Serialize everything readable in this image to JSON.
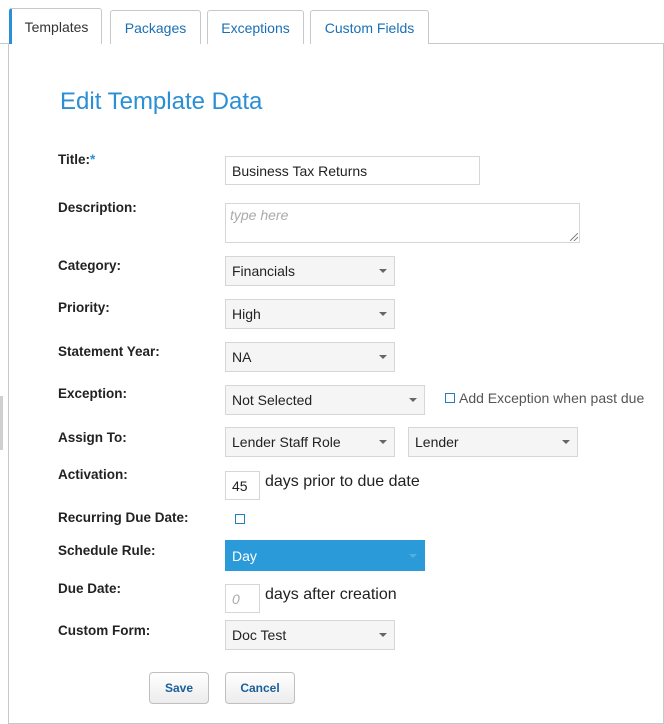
{
  "tabs": [
    {
      "label": "Templates",
      "active": true
    },
    {
      "label": "Packages",
      "active": false
    },
    {
      "label": "Exceptions",
      "active": false
    },
    {
      "label": "Custom Fields",
      "active": false
    }
  ],
  "page_title": "Edit Template Data",
  "form": {
    "title": {
      "label": "Title:",
      "required_mark": "*",
      "value": "Business Tax Returns"
    },
    "description": {
      "label": "Description:",
      "placeholder": "type here",
      "value": ""
    },
    "category": {
      "label": "Category:",
      "value": "Financials"
    },
    "priority": {
      "label": "Priority:",
      "value": "High"
    },
    "statement_year": {
      "label": "Statement Year:",
      "value": "NA"
    },
    "exception": {
      "label": "Exception:",
      "value": "Not Selected",
      "checkbox_label": "Add Exception when past due",
      "checked": false
    },
    "assign_to": {
      "label": "Assign To:",
      "role_value": "Lender Staff Role",
      "party_value": "Lender"
    },
    "activation": {
      "label": "Activation:",
      "value": "45",
      "suffix": "days prior to due date"
    },
    "recurring_due_date": {
      "label": "Recurring Due Date:",
      "checked": false
    },
    "schedule_rule": {
      "label": "Schedule Rule:",
      "value": "Day"
    },
    "due_date": {
      "label": "Due Date:",
      "placeholder": "0",
      "suffix": "days after creation"
    },
    "custom_form": {
      "label": "Custom Form:",
      "value": "Doc Test"
    }
  },
  "buttons": {
    "save": "Save",
    "cancel": "Cancel"
  },
  "colors": {
    "accent": "#2a8fd4",
    "schedule_select": "#2b9ad8",
    "tab_link": "#1a6fb5"
  }
}
